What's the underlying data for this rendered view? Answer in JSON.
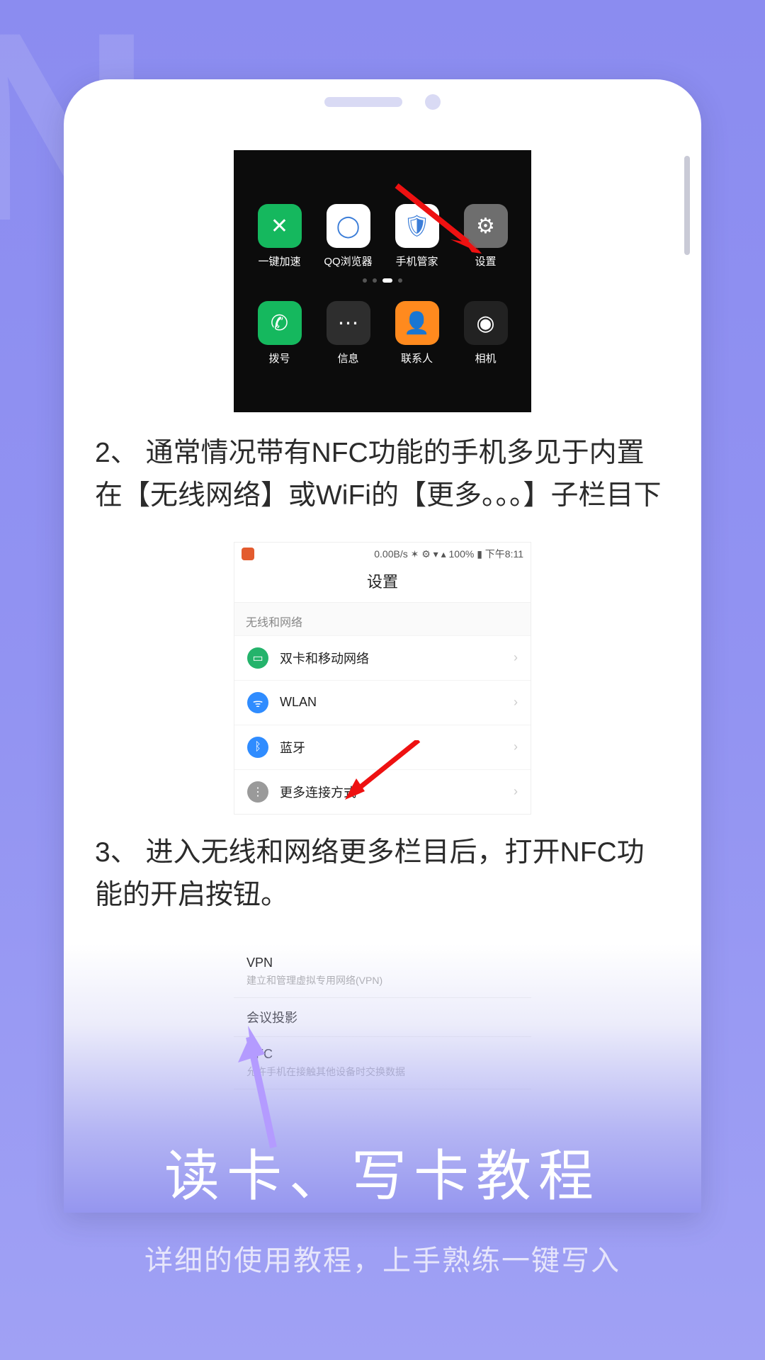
{
  "launcher": {
    "row1": [
      {
        "label": "一键加速"
      },
      {
        "label": "QQ浏览器"
      },
      {
        "label": "手机管家"
      },
      {
        "label": "设置"
      }
    ],
    "row2": [
      {
        "label": "拨号"
      },
      {
        "label": "信息"
      },
      {
        "label": "联系人"
      },
      {
        "label": "相机"
      }
    ]
  },
  "step2": "2、 通常情况带有NFC功能的手机多见于内置在【无线网络】或WiFi的【更多。。。】子栏目下",
  "settings": {
    "status": "0.00B/s ✶ ⚙ ▾ ▴ 100% ▮ 下午8:11",
    "title": "设置",
    "section": "无线和网络",
    "rows": [
      {
        "label": "双卡和移动网络"
      },
      {
        "label": "WLAN"
      },
      {
        "label": "蓝牙"
      },
      {
        "label": "更多连接方式"
      }
    ]
  },
  "step3": "3、 进入无线和网络更多栏目后，打开NFC功能的开启按钮。",
  "more": {
    "rows": [
      {
        "title": "VPN",
        "sub": "建立和管理虚拟专用网络(VPN)"
      },
      {
        "title": "会议投影",
        "sub": ""
      },
      {
        "title": "NFC",
        "sub": "允许手机在接触其他设备时交换数据"
      }
    ]
  },
  "promo": {
    "title": "读卡、写卡教程",
    "sub": "详细的使用教程，上手熟练一键写入"
  }
}
